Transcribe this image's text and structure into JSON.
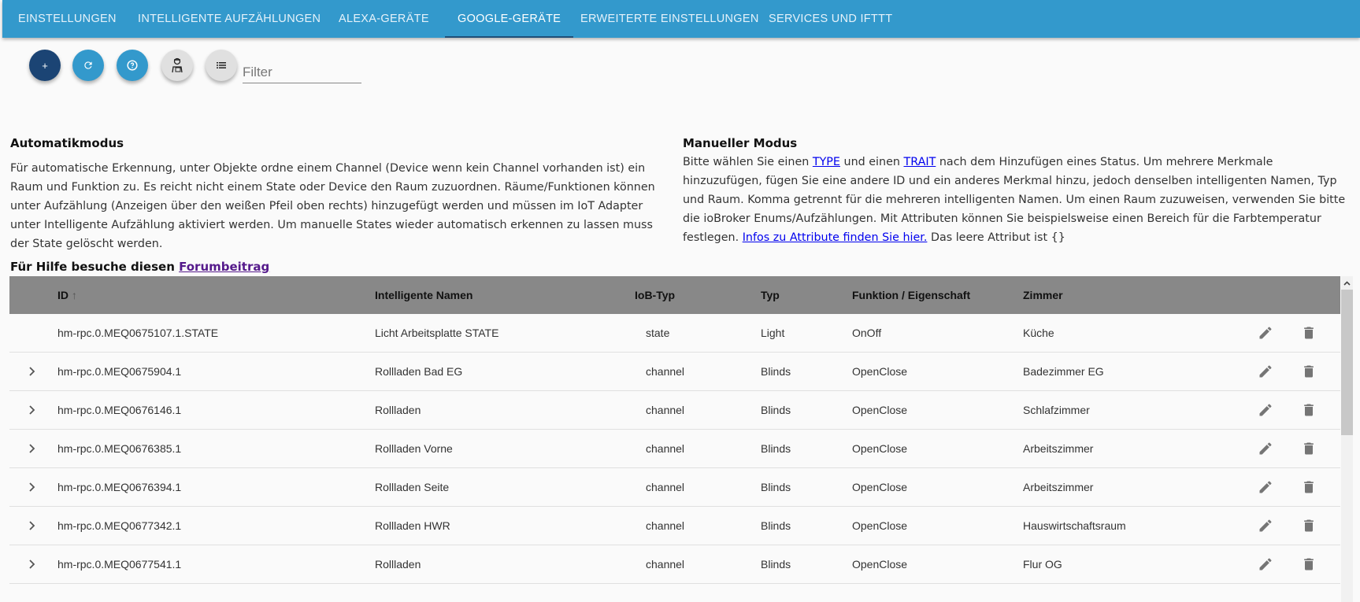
{
  "tabs": [
    "EINSTELLUNGEN",
    "INTELLIGENTE AUFZÄHLUNGEN",
    "ALEXA-GERÄTE",
    "GOOGLE-GERÄTE",
    "ERWEITERTE EINSTELLUNGEN",
    "SERVICES UND IFTTT"
  ],
  "active_tab": "GOOGLE-GERÄTE",
  "toolbar": {
    "add": "+",
    "filter_placeholder": "Filter"
  },
  "colors": {
    "header": "#3399cc",
    "add_button": "#1b4474",
    "button": "#3399cc",
    "table_header": "#888888"
  },
  "auto": {
    "title": "Automatikmodus",
    "text": "Für automatische Erkennung, unter Objekte ordne einem Channel (Device wenn kein Channel vorhanden ist) ein Raum und Funktion zu. Es reicht nicht einem State oder Device den Raum zuzuordnen. Räume/Funktionen können unter Aufzählung (Anzeigen über den weißen Pfeil oben rechts) hinzugefügt werden und müssen im IoT Adapter unter Intelligente Aufzählung aktiviert werden. Um manuelle States wieder automatisch erkennen zu lassen muss der State gelöscht werden."
  },
  "manual": {
    "title": "Manueller Modus",
    "t1": "Bitte wählen Sie einen ",
    "type_link": "TYPE",
    "t2": " und einen ",
    "trait_link": "TRAIT",
    "t3": " nach dem Hinzufügen eines Status. Um mehrere Merkmale hinzuzufügen, fügen Sie eine andere ID und ein anderes Merkmal hinzu, jedoch denselben intelligenten Namen, Typ und Raum. Komma getrennt für die mehreren intelligenten Namen. Um einen Raum zuzuweisen, verwenden Sie bitte die ioBroker Enums/Aufzählungen. Mit Attributen können Sie beispielsweise einen Bereich für die Farbtemperatur festlegen. ",
    "attr_link": "Infos zu Attribute finden Sie hier.",
    "t4": " Das leere Attribut ist {}"
  },
  "help": {
    "text": "Für Hilfe besuche diesen ",
    "link": "Forumbeitrag"
  },
  "table": {
    "headers": {
      "id": "ID",
      "sort": "↑",
      "names": "Intelligente Namen",
      "iob": "IoB-Typ",
      "typ": "Typ",
      "func": "Funktion / Eigenschaft",
      "room": "Zimmer"
    },
    "rows": [
      {
        "id": "hm-rpc.0.MEQ0675107.1.STATE",
        "name": "Licht Arbeitsplatte STATE",
        "iob": "state",
        "typ": "Light",
        "func": "OnOff",
        "room": "Küche",
        "expand": false
      },
      {
        "id": "hm-rpc.0.MEQ0675904.1",
        "name": "Rollladen Bad EG",
        "iob": "channel",
        "typ": "Blinds",
        "func": "OpenClose",
        "room": "Badezimmer EG",
        "expand": true
      },
      {
        "id": "hm-rpc.0.MEQ0676146.1",
        "name": "Rollladen",
        "iob": "channel",
        "typ": "Blinds",
        "func": "OpenClose",
        "room": "Schlafzimmer",
        "expand": true
      },
      {
        "id": "hm-rpc.0.MEQ0676385.1",
        "name": "Rollladen Vorne",
        "iob": "channel",
        "typ": "Blinds",
        "func": "OpenClose",
        "room": "Arbeitszimmer",
        "expand": true
      },
      {
        "id": "hm-rpc.0.MEQ0676394.1",
        "name": "Rollladen Seite",
        "iob": "channel",
        "typ": "Blinds",
        "func": "OpenClose",
        "room": "Arbeitszimmer",
        "expand": true
      },
      {
        "id": "hm-rpc.0.MEQ0677342.1",
        "name": "Rollladen HWR",
        "iob": "channel",
        "typ": "Blinds",
        "func": "OpenClose",
        "room": "Hauswirtschaftsraum",
        "expand": true
      },
      {
        "id": "hm-rpc.0.MEQ0677541.1",
        "name": "Rollladen",
        "iob": "channel",
        "typ": "Blinds",
        "func": "OpenClose",
        "room": "Flur OG",
        "expand": true
      }
    ]
  }
}
